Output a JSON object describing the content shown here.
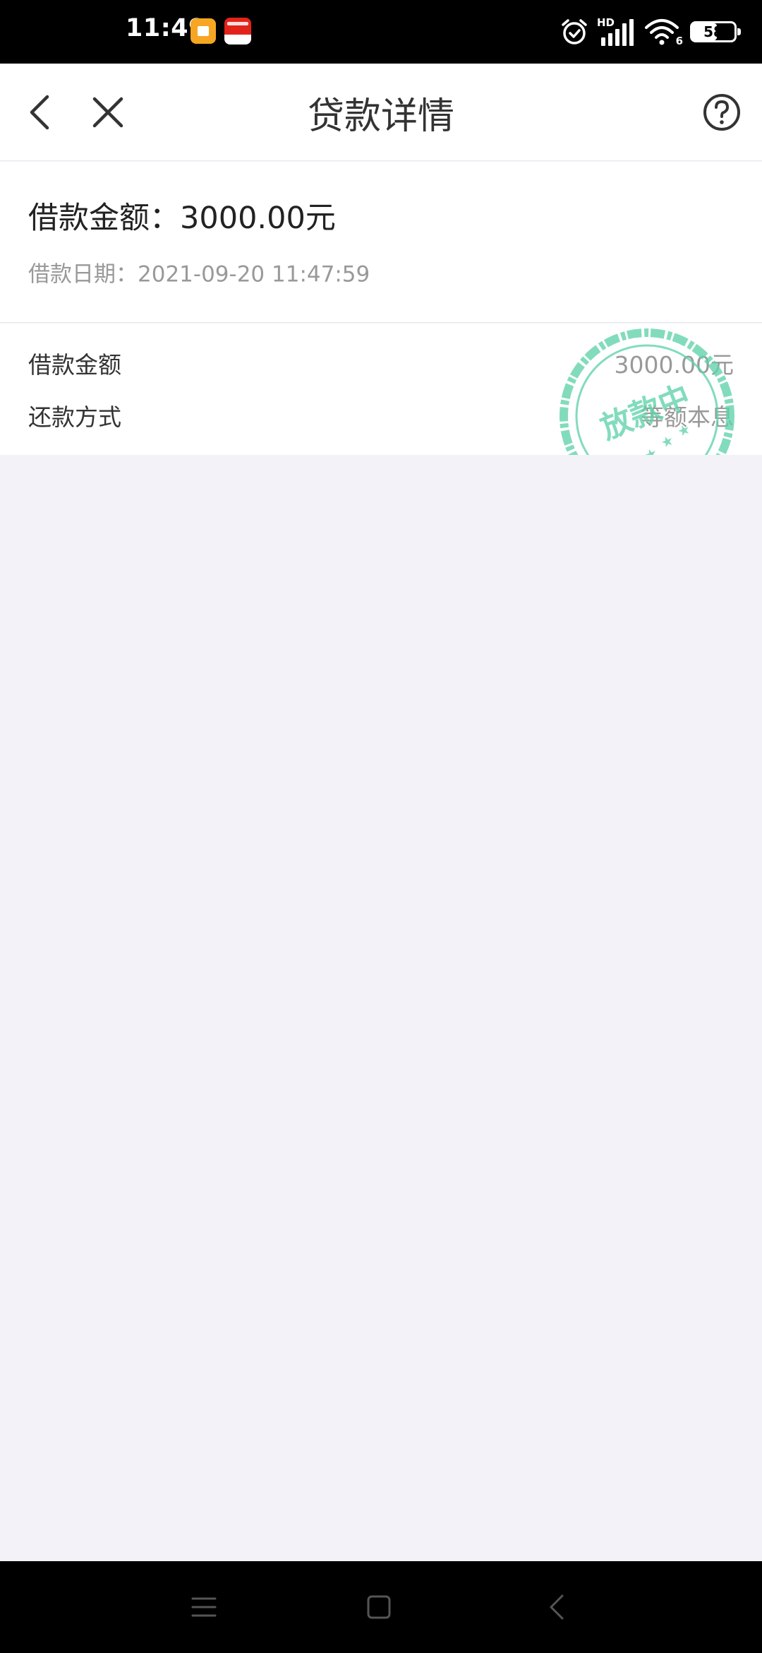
{
  "status_bar": {
    "time": "11:49",
    "network_label": "HD",
    "wifi_label": "6",
    "battery_level": 58,
    "battery_text": "58",
    "icons": [
      "notification-app-icon",
      "news-app-icon",
      "alarm-icon",
      "signal-icon",
      "wifi-icon",
      "battery-icon"
    ]
  },
  "app_bar": {
    "title": "贷款详情",
    "back_icon": "chevron-left-icon",
    "close_icon": "close-icon",
    "help_icon": "question-circle-icon"
  },
  "summary": {
    "amount_label": "借款金额：3000.00元",
    "date_label": "借款日期：2021-09-20 11:47:59"
  },
  "details": {
    "rows": [
      {
        "label": "借款金额",
        "value": "3000.00元"
      },
      {
        "label": "还款方式",
        "value": "等额本息"
      }
    ]
  },
  "stamp": {
    "text": "放款中",
    "color": "#5fd3a8"
  },
  "nav_bar": {
    "icons": [
      "menu-icon",
      "home-square-icon",
      "back-triangle-icon"
    ]
  },
  "colors": {
    "background": "#f2f2f8",
    "surface": "#ffffff",
    "text_primary": "#222222",
    "text_secondary": "#999999",
    "stamp": "#5fd3a8"
  }
}
